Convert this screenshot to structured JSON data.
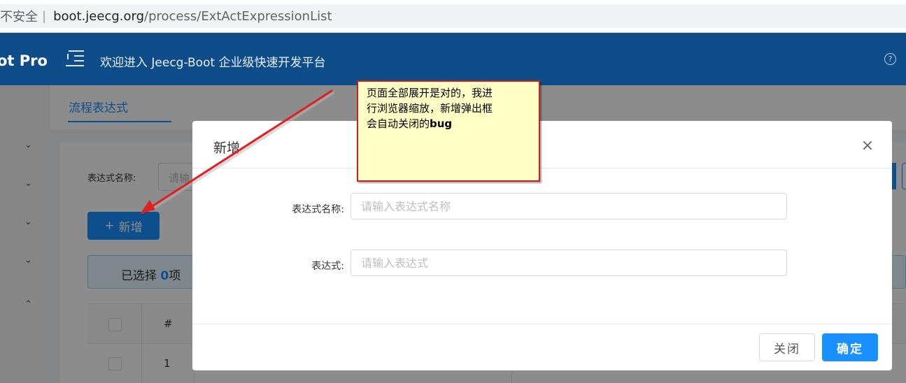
{
  "browser": {
    "security_text": "不安全",
    "separator": "|",
    "url_host": "boot.jeecg.org",
    "url_path": "/process/ExtActExpressionList"
  },
  "header": {
    "logo_text": "ot Pro",
    "welcome": "欢迎进入 Jeecg-Boot 企业级快速开发平台",
    "help_icon": "question-circle-icon",
    "background": "#0e4c8a"
  },
  "sidebar": {
    "items": [
      {
        "icon": "chevron-down-icon",
        "glyph": "⌄"
      },
      {
        "icon": "chevron-down-icon",
        "glyph": "⌄"
      },
      {
        "icon": "chevron-down-icon",
        "glyph": "⌄"
      },
      {
        "icon": "chevron-down-icon",
        "glyph": "⌄"
      },
      {
        "icon": "chevron-up-icon",
        "glyph": "⌃"
      }
    ]
  },
  "tabs": {
    "active": "流程表达式"
  },
  "page": {
    "search_label": "表达式名称:",
    "search_placeholder": "请输",
    "add_button": "新增",
    "add_icon": "+",
    "alert_prefix": "已选择 ",
    "alert_count": "0",
    "alert_suffix": "项",
    "table_header_index": "#",
    "first_row_index": "1"
  },
  "modal": {
    "title": "新增",
    "close_icon": "×",
    "fields": [
      {
        "label": "表达式名称",
        "placeholder": "请输入表达式名称",
        "value": ""
      },
      {
        "label": "表达式",
        "placeholder": "请输入表达式",
        "value": ""
      }
    ],
    "cancel_label": "关闭",
    "ok_label": "确定"
  },
  "annotation": {
    "text_line1": "页面全部展开是对的，我进",
    "text_line2": "行浏览器缩放，新增弹出框",
    "text_line3_prefix": "会自动关闭的",
    "text_line3_bold": "bug",
    "arrow_color": "#e02020"
  },
  "colors": {
    "primary": "#1890ff",
    "note_background": "#ffffc6",
    "note_border": "#cc1f1f"
  }
}
